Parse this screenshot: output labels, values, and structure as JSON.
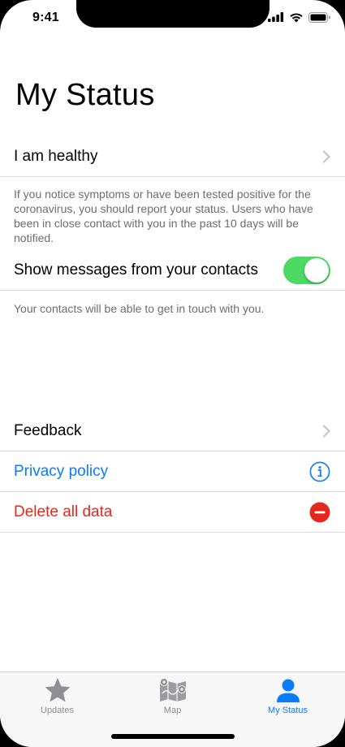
{
  "status_bar": {
    "time": "9:41"
  },
  "page": {
    "title": "My Status"
  },
  "health_row": {
    "label": "I am healthy",
    "footnote": "If you notice symptoms or have been tested positive for the coronavirus, you should report your status. Users who have been in close contact with you in the past 10 days will be notified."
  },
  "contacts_row": {
    "label": "Show messages from your contacts",
    "toggle_on": true,
    "footnote": "Your contacts will be able to get in touch with you."
  },
  "feedback_row": {
    "label": "Feedback"
  },
  "privacy_row": {
    "label": "Privacy policy"
  },
  "delete_row": {
    "label": "Delete all data"
  },
  "tabs": [
    {
      "label": "Updates",
      "icon": "star-icon",
      "active": false
    },
    {
      "label": "Map",
      "icon": "map-icon",
      "active": false
    },
    {
      "label": "My Status",
      "icon": "person-icon",
      "active": true
    }
  ],
  "colors": {
    "accent": "#0a7aff",
    "destructive": "#e5281e",
    "toggle_on": "#4cd964",
    "inactive_tab": "#8e8e93"
  }
}
